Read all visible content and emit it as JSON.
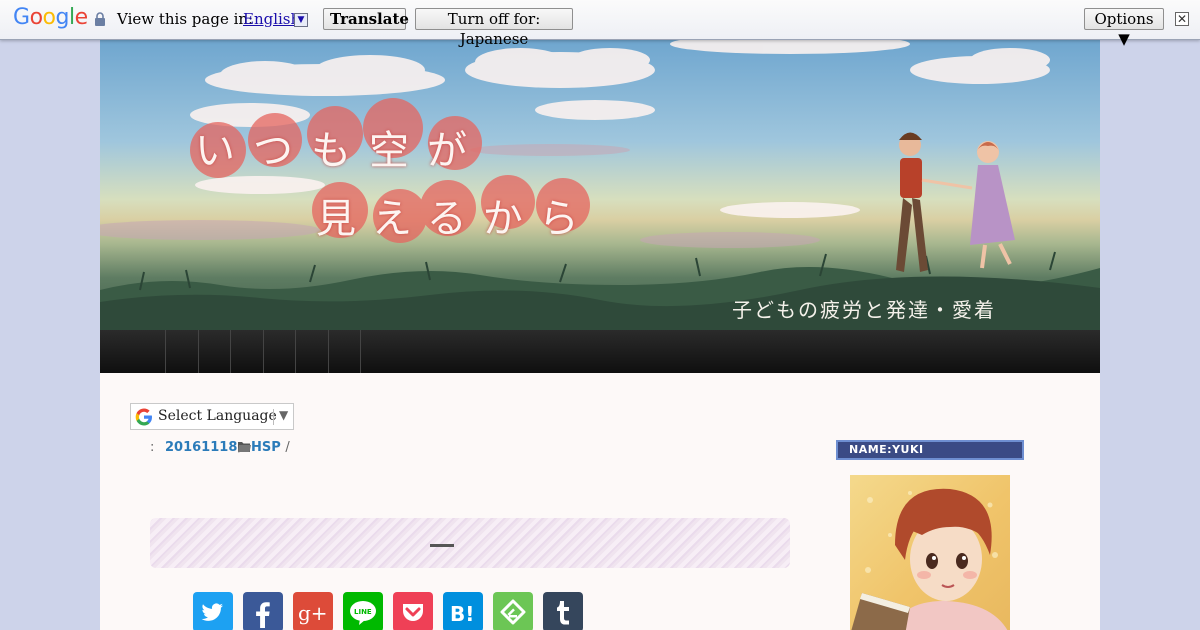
{
  "translate_bar": {
    "logo_letters": [
      {
        "ch": "G",
        "color": "#4285f4"
      },
      {
        "ch": "o",
        "color": "#ea4335"
      },
      {
        "ch": "o",
        "color": "#fbbc05"
      },
      {
        "ch": "g",
        "color": "#4285f4"
      },
      {
        "ch": "l",
        "color": "#34a853"
      },
      {
        "ch": "e",
        "color": "#ea4335"
      }
    ],
    "view_text": "View this page in:",
    "language": "English",
    "translate_label": "Translate",
    "turn_off_label": "Turn off for: Japanese",
    "options_label": "Options ▼",
    "close_label": "✕"
  },
  "header": {
    "title_line1": "いつも空が",
    "title_line2": "見えるから",
    "subtitle": "子どもの疲労と発達・愛着"
  },
  "nav": {
    "item_count": 7
  },
  "language_selector": {
    "label": "Select Language",
    "arrow": "▼"
  },
  "post_meta": {
    "prefix": ":",
    "date": "20161118",
    "separator": ",",
    "category": "HSP",
    "trailing": "/"
  },
  "share_buttons": [
    {
      "name": "twitter",
      "color": "#1da1f2"
    },
    {
      "name": "facebook",
      "color": "#3b5998"
    },
    {
      "name": "googleplus",
      "color": "#dd4b39"
    },
    {
      "name": "line",
      "color": "#00b900"
    },
    {
      "name": "pocket",
      "color": "#ef4056"
    },
    {
      "name": "hatena",
      "color": "#008fde"
    },
    {
      "name": "feedly",
      "color": "#6cc655"
    },
    {
      "name": "tumblr",
      "color": "#35465c"
    }
  ],
  "sidebar": {
    "profile_heading": "NAME:YUKI"
  }
}
